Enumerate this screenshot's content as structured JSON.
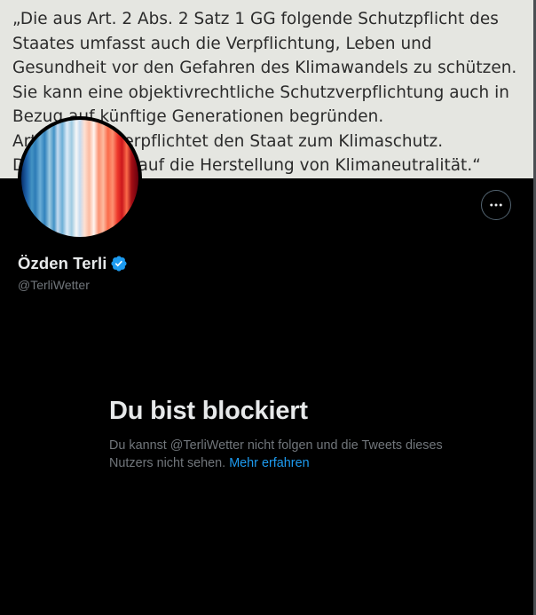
{
  "banner": {
    "lines": [
      "„Die aus Art. 2 Abs. 2 Satz 1 GG folgende Schutzpflicht des",
      "Staates umfasst auch die Verpflichtung, Leben und",
      "Gesundheit vor den Gefahren des Klimawandels zu schützen.",
      "Sie kann eine objektivrechtliche Schutzverpflichtung auch in",
      "Bezug auf künftige Generationen begründen.",
      "Art. 20a GG verpflichtet den Staat zum Klimaschutz.",
      "Dies zielt auch auf die Herstellung von Klimaneutralität.“"
    ]
  },
  "profile": {
    "display_name": "Özden Terli",
    "handle": "@TerliWetter",
    "verified_icon": "verified-badge-icon",
    "avatar_icon": "warming-stripes-icon",
    "more_icon": "more-horizontal-icon"
  },
  "blocked": {
    "title": "Du bist blockiert",
    "message": "Du kannst @TerliWetter nicht folgen und die Tweets dieses Nutzers nicht sehen.",
    "learn_more": "Mehr erfahren"
  },
  "colors": {
    "background": "#000000",
    "banner_bg": "#e5e6e1",
    "primary_text": "#e7e9ea",
    "secondary_text": "#71767b",
    "accent": "#1d9bf0"
  }
}
